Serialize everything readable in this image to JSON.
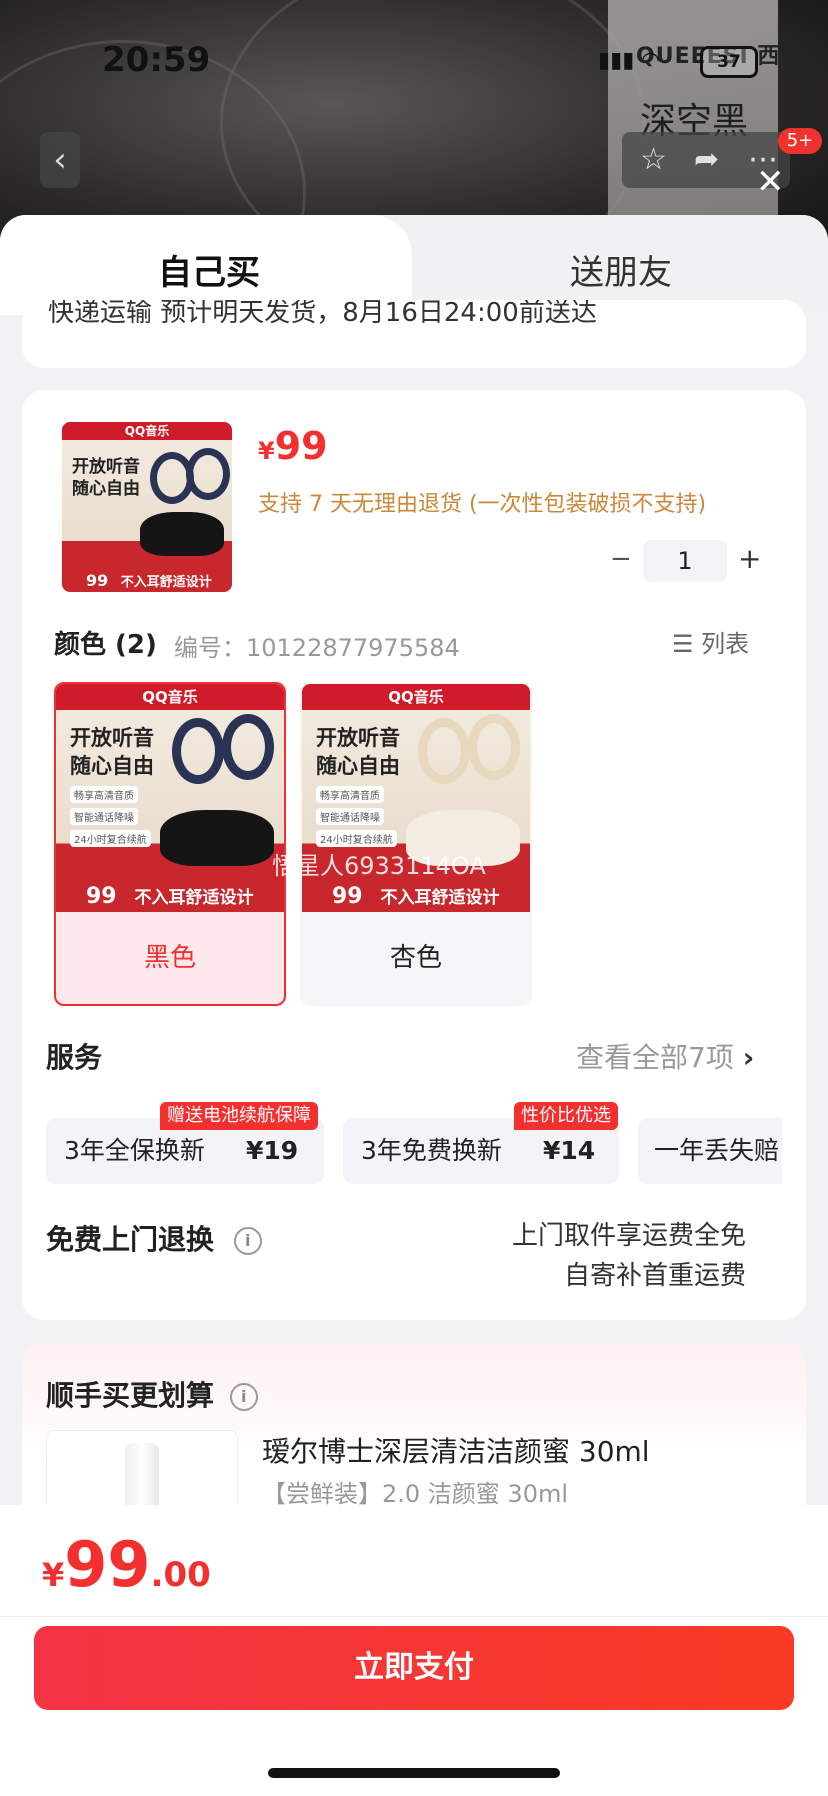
{
  "status_bar": {
    "time": "20:59",
    "battery": "37"
  },
  "background": {
    "brand": "QUEEESI 西氏",
    "color_text": "深空黑",
    "cart_badge": "5+"
  },
  "tabs": {
    "self": "自己买",
    "gift": "送朋友"
  },
  "shipping": {
    "text": "快递运输 预计明天发货，8月16日24:00前送达"
  },
  "product": {
    "currency": "¥",
    "price": "99",
    "return_policy": "支持 7 天无理由退货 (一次性包装破损不支持)",
    "quantity": "1",
    "minus": "−",
    "plus": "+"
  },
  "thumb": {
    "brand": "QQ音乐",
    "line1": "开放听音",
    "line2": "随心自由",
    "features": [
      "畅享高清音质",
      "智能通话降噪",
      "24小时复合续航"
    ],
    "footer_price": "99",
    "footer_text": "不入耳舒适设计"
  },
  "colors": {
    "label": "颜色 (2)",
    "code_label": "编号：",
    "code": "10122877975584",
    "list_label": "列表",
    "options": [
      {
        "name": "黑色",
        "selected": true
      },
      {
        "name": "杏色",
        "selected": false
      }
    ],
    "watermark": "悟星人6933114OA"
  },
  "services": {
    "title": "服务",
    "view_all": "查看全部7项",
    "items": [
      {
        "name": "3年全保换新",
        "price": "¥19",
        "tag": "赠送电池续航保障"
      },
      {
        "name": "3年免费换新",
        "price": "¥14",
        "tag": "性价比优选"
      },
      {
        "name": "一年丢失赔",
        "price": "",
        "tag": ""
      }
    ],
    "door_title": "免费上门退换",
    "door_line1": "上门取件享运费全免",
    "door_line2": "自寄补首重运费"
  },
  "addon": {
    "title": "顺手买更划算",
    "product_title": "瑷尔博士深层清洁洁颜蜜 30ml",
    "product_sub": "【尝鲜装】2.0 洁颜蜜 30ml"
  },
  "footer": {
    "currency": "¥",
    "price_int": "99",
    "price_dec": ".00",
    "pay_label": "立即支付"
  },
  "colors_theme": {
    "accent": "#f23030",
    "price_orange": "#c9883a",
    "selected_bg": "#fde8ec"
  }
}
